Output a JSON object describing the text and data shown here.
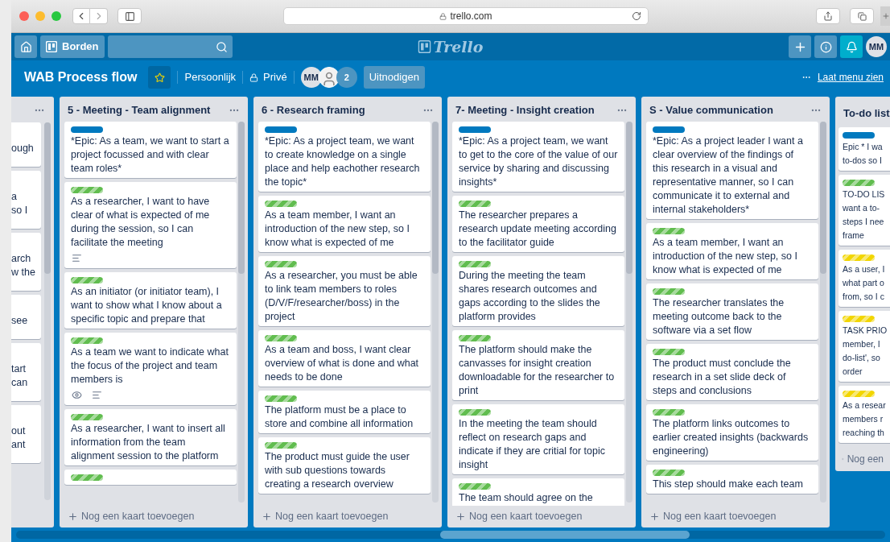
{
  "browser": {
    "url": "trello.com"
  },
  "header": {
    "boards_label": "Borden",
    "logo": "Trello",
    "user_initials": "MM"
  },
  "board": {
    "title": "WAB Process flow",
    "starred": true,
    "team": "Persoonlijk",
    "visibility": "Privé",
    "members": [
      {
        "kind": "initials",
        "initials": "MM"
      },
      {
        "kind": "photo"
      }
    ],
    "member_count": "2",
    "invite": "Uitnodigen",
    "menu": "Laat menu zien"
  },
  "lists": [
    {
      "kind": "cut-left",
      "cards": [
        {
          "lines": [
            "ough"
          ]
        },
        {
          "lines": [
            "a",
            "so I"
          ]
        },
        {
          "lines": [
            "arch",
            "w the"
          ]
        },
        {
          "lines": [
            "see"
          ]
        },
        {
          "lines": [
            "tart",
            "can"
          ]
        },
        {
          "lines": [
            "out",
            "ant"
          ]
        }
      ]
    },
    {
      "kind": "full",
      "title": "5 - Meeting - Team alignment",
      "add_card": "Nog een kaart toevoegen",
      "cards": [
        {
          "labels": [
            {
              "color": "#0079bf",
              "striped": false
            }
          ],
          "text": "*Epic: As a team, we want to start a project focussed and with clear team roles*"
        },
        {
          "labels": [
            {
              "color": "#61bd4f",
              "striped": true
            }
          ],
          "text": "As a researcher, I want to have clear of what is expected of me during the session, so I can facilitate the meeting",
          "badges": [
            {
              "kind": "description"
            }
          ]
        },
        {
          "labels": [
            {
              "color": "#61bd4f",
              "striped": true
            }
          ],
          "text": "As an initiator (or initiator team), I want to show what I know about a specific topic and prepare that"
        },
        {
          "labels": [
            {
              "color": "#61bd4f",
              "striped": true
            }
          ],
          "text": "As a team we want to indicate what the focus of the project and team members is",
          "badges": [
            {
              "kind": "watch"
            },
            {
              "kind": "description"
            }
          ]
        },
        {
          "labels": [
            {
              "color": "#61bd4f",
              "striped": true
            }
          ],
          "text": "As a researcher, I want to insert all information from the team alignment session to the platform"
        },
        {
          "labels": [
            {
              "color": "#61bd4f",
              "striped": true
            }
          ]
        }
      ]
    },
    {
      "kind": "full",
      "title": "6 - Research framing",
      "add_card": "Nog een kaart toevoegen",
      "cards": [
        {
          "labels": [
            {
              "color": "#0079bf",
              "striped": false
            }
          ],
          "text": "*Epic: As a project team, we want to create knowledge on a single place and help eachother research the topic*"
        },
        {
          "labels": [
            {
              "color": "#61bd4f",
              "striped": true
            }
          ],
          "text": "As a team member, I want an introduction of the new step, so I know what is expected of me"
        },
        {
          "labels": [
            {
              "color": "#61bd4f",
              "striped": true
            }
          ],
          "text": "As a researcher, you must be able to link team members to roles (D/V/F/researcher/boss) in the project"
        },
        {
          "labels": [
            {
              "color": "#61bd4f",
              "striped": true
            }
          ],
          "text": "As a team and boss, I want clear overview of what is done and what needs to be done"
        },
        {
          "labels": [
            {
              "color": "#61bd4f",
              "striped": true
            }
          ],
          "text": "The platform must be a place to store and combine all information"
        },
        {
          "labels": [
            {
              "color": "#61bd4f",
              "striped": true
            }
          ],
          "text": "The product must guide the user with sub questions towards creating a research overview"
        }
      ]
    },
    {
      "kind": "full",
      "title": "7- Meeting - Insight creation",
      "add_card": "Nog een kaart toevoegen",
      "cards": [
        {
          "labels": [
            {
              "color": "#0079bf",
              "striped": false
            }
          ],
          "text": "*Epic: As a project team, we want to get to the core of the value of our service by sharing and discussing insights*"
        },
        {
          "labels": [
            {
              "color": "#61bd4f",
              "striped": true
            }
          ],
          "text": "The researcher prepares a research update meeting according to the facilitator guide"
        },
        {
          "labels": [
            {
              "color": "#61bd4f",
              "striped": true
            }
          ],
          "text": "During the meeting the team shares research outcomes and gaps according to the slides the platform provides"
        },
        {
          "labels": [
            {
              "color": "#61bd4f",
              "striped": true
            }
          ],
          "text": "The platform should make the canvasses for insight creation downloadable for the researcher to print"
        },
        {
          "labels": [
            {
              "color": "#61bd4f",
              "striped": true
            }
          ],
          "text": "In the meeting the team should reflect on research gaps and indicate if they are critial for topic insight"
        },
        {
          "labels": [
            {
              "color": "#61bd4f",
              "striped": true
            }
          ],
          "text": "The team should agree on the"
        }
      ]
    },
    {
      "kind": "full",
      "title": "S - Value communication",
      "add_card": "Nog een kaart toevoegen",
      "cards": [
        {
          "labels": [
            {
              "color": "#0079bf",
              "striped": false
            }
          ],
          "text": "*Epic: As a project leader I want a clear overview of the findings of this research in a visual and representative manner, so I can communicate it to external and internal stakeholders*"
        },
        {
          "labels": [
            {
              "color": "#61bd4f",
              "striped": true
            }
          ],
          "text": "As a team member, I want an introduction of the new step, so I know what is expected of me"
        },
        {
          "labels": [
            {
              "color": "#61bd4f",
              "striped": true
            }
          ],
          "text": "The researcher translates the meeting outcome back to the software via a set flow"
        },
        {
          "labels": [
            {
              "color": "#61bd4f",
              "striped": true
            }
          ],
          "text": "The product must conclude the research in a set slide deck of steps and conclusions"
        },
        {
          "labels": [
            {
              "color": "#61bd4f",
              "striped": true
            }
          ],
          "text": "The platform links outcomes to earlier created insights (backwards engineering)"
        },
        {
          "labels": [
            {
              "color": "#61bd4f",
              "striped": true
            }
          ],
          "text": "This step should make each team"
        }
      ]
    },
    {
      "kind": "cut-right",
      "title": "To-do list",
      "add_card": "Nog een",
      "cards": [
        {
          "labels": [
            {
              "color": "#0079bf",
              "striped": false
            }
          ],
          "lines": [
            "Epic * I wa",
            "to-dos so I"
          ]
        },
        {
          "labels": [
            {
              "color": "#61bd4f",
              "striped": true
            }
          ],
          "lines": [
            "TO-DO LIS",
            "want a to-",
            "steps I nee",
            "frame"
          ]
        },
        {
          "labels": [
            {
              "color": "#f2d600",
              "striped": true
            }
          ],
          "lines": [
            "As a user, I",
            "what part o",
            "from, so I c"
          ]
        },
        {
          "labels": [
            {
              "color": "#f2d600",
              "striped": true
            }
          ],
          "lines": [
            "TASK PRIO",
            "member, I",
            "do-list', so",
            "order"
          ]
        },
        {
          "labels": [
            {
              "color": "#f2d600",
              "striped": true
            }
          ],
          "lines": [
            "As a resear",
            "members r",
            "reaching th"
          ]
        }
      ]
    }
  ]
}
